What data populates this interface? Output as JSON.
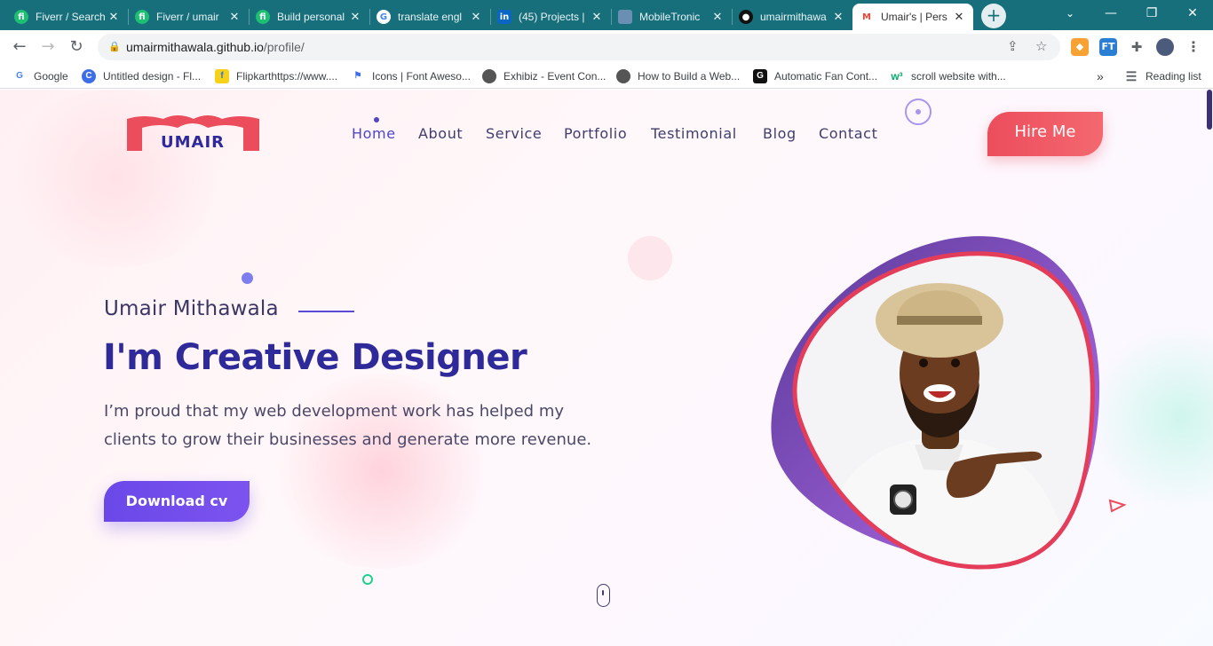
{
  "browser": {
    "tabs": [
      {
        "title": "Fiverr / Search",
        "icon": "fiverr-icon",
        "active": false
      },
      {
        "title": "Fiverr / umair",
        "icon": "fiverr-icon",
        "active": false
      },
      {
        "title": "Build personal",
        "icon": "fiverr-icon",
        "active": false
      },
      {
        "title": "translate engl",
        "icon": "google-icon",
        "active": false
      },
      {
        "title": "(45) Projects |",
        "icon": "linkedin-icon",
        "active": false
      },
      {
        "title": "MobileTronic",
        "icon": "globe-icon",
        "active": false
      },
      {
        "title": "umairmithawa",
        "icon": "github-icon",
        "active": false
      },
      {
        "title": "Umair's | Pers",
        "icon": "gmail-icon",
        "active": true
      }
    ],
    "new_tab_symbol": "+",
    "url_host": "umairmithawala.github.io",
    "url_path": "/profile/",
    "bookmarks": [
      {
        "label": "Google",
        "icon": "google-icon"
      },
      {
        "label": "Untitled design - Fl...",
        "icon": "canva-icon"
      },
      {
        "label": "Flipkarthttps://www....",
        "icon": "flipkart-icon"
      },
      {
        "label": "Icons | Font Aweso...",
        "icon": "flag-icon"
      },
      {
        "label": "Exhibiz - Event Con...",
        "icon": "globe-icon"
      },
      {
        "label": "How to Build a Web...",
        "icon": "globe-icon"
      },
      {
        "label": "Automatic Fan Cont...",
        "icon": "g-icon"
      },
      {
        "label": "scroll website with...",
        "icon": "w3-icon"
      }
    ],
    "bookmarks_overflow": "»",
    "reading_list": "Reading list",
    "ext_labels": [
      "FT"
    ]
  },
  "site": {
    "logo_text": "UMAIR",
    "nav": [
      "Home",
      "About",
      "Service",
      "Portfolio",
      "Testimonial",
      "Blog",
      "Contact"
    ],
    "nav_active": "Home",
    "hire_label": "Hire Me",
    "hero": {
      "name": "Umair Mithawala",
      "headline": "I'm Creative Designer",
      "description": "I’m proud that my web development work has helped my clients to grow their businesses and generate more revenue.",
      "cta": "Download cv"
    },
    "colors": {
      "accent": "#4e45c7",
      "heading": "#2e2a9a",
      "brand_red": "#ec4d5c",
      "cta_purple": "#6a48e8",
      "browser_frame": "#176F7C"
    }
  }
}
